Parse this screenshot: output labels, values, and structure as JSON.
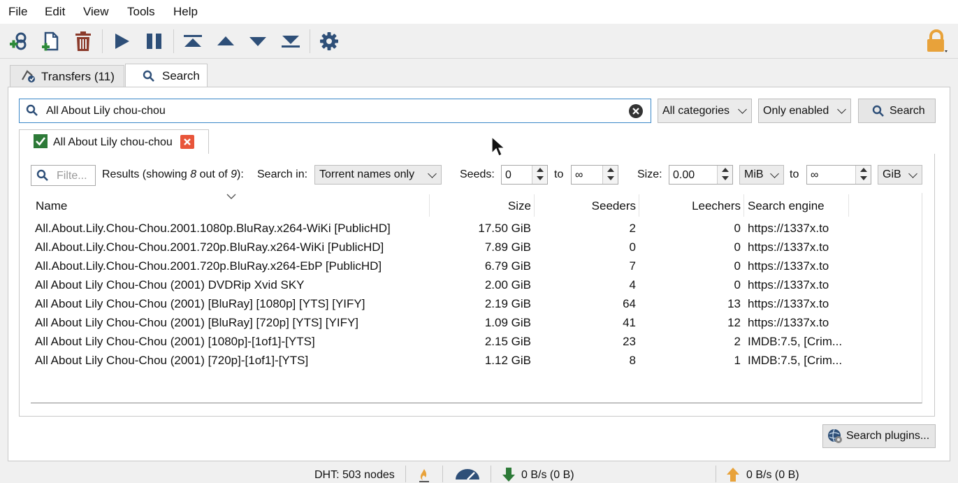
{
  "menu": {
    "items": [
      "File",
      "Edit",
      "View",
      "Tools",
      "Help"
    ]
  },
  "tabs": {
    "transfers_label": "Transfers (11)",
    "search_label": "Search"
  },
  "search": {
    "query": "All About Lily chou-chou",
    "category": "All categories",
    "plugins_filter": "Only enabled",
    "button_label": "Search"
  },
  "result_tab": {
    "label": "All About Lily chou-chou"
  },
  "filters": {
    "filter_placeholder": "Filte...",
    "results_text": "Results (showing ",
    "showing": "8",
    "out_of_text": " out of ",
    "total": "9",
    "results_end": "):",
    "search_in_label": "Search in:",
    "search_in_value": "Torrent names only",
    "seeds_label": "Seeds:",
    "seeds_min": "0",
    "to_label": "to",
    "seeds_max": "∞",
    "size_label": "Size:",
    "size_min": "0.00",
    "size_min_unit": "MiB",
    "size_max": "∞",
    "size_max_unit": "GiB"
  },
  "table": {
    "headers": {
      "name": "Name",
      "size": "Size",
      "seeders": "Seeders",
      "leechers": "Leechers",
      "engine": "Search engine"
    },
    "rows": [
      {
        "name": "All.About.Lily.Chou-Chou.2001.1080p.BluRay.x264-WiKi [PublicHD]",
        "size": "17.50 GiB",
        "seeders": "2",
        "leechers": "0",
        "engine": "https://1337x.to"
      },
      {
        "name": "All.About.Lily.Chou-Chou.2001.720p.BluRay.x264-WiKi [PublicHD]",
        "size": "7.89 GiB",
        "seeders": "0",
        "leechers": "0",
        "engine": "https://1337x.to"
      },
      {
        "name": "All.About.Lily.Chou-Chou.2001.720p.BluRay.x264-EbP [PublicHD]",
        "size": "6.79 GiB",
        "seeders": "7",
        "leechers": "0",
        "engine": "https://1337x.to"
      },
      {
        "name": "All About Lily Chou-Chou (2001) DVDRip Xvid SKY",
        "size": "2.00 GiB",
        "seeders": "4",
        "leechers": "0",
        "engine": "https://1337x.to"
      },
      {
        "name": "All About Lily Chou-Chou (2001) [BluRay] [1080p] [YTS] [YIFY]",
        "size": "2.19 GiB",
        "seeders": "64",
        "leechers": "13",
        "engine": "https://1337x.to"
      },
      {
        "name": "All About Lily Chou-Chou (2001) [BluRay] [720p] [YTS] [YIFY]",
        "size": "1.09 GiB",
        "seeders": "41",
        "leechers": "12",
        "engine": "https://1337x.to"
      },
      {
        "name": "All About Lily Chou-Chou (2001) [1080p]-[1of1]-[YTS]",
        "size": "2.15 GiB",
        "seeders": "23",
        "leechers": "2",
        "engine": "IMDB:7.5, [Crim..."
      },
      {
        "name": "All About Lily Chou-Chou (2001) [720p]-[1of1]-[YTS]",
        "size": "1.12 GiB",
        "seeders": "8",
        "leechers": "1",
        "engine": "IMDB:7.5, [Crim..."
      }
    ]
  },
  "plugins_button": "Search plugins...",
  "status": {
    "dht": "DHT: 503 nodes",
    "download": "0 B/s (0 B)",
    "upload": "0 B/s (0 B)"
  },
  "colors": {
    "accent": "#3a87c8",
    "icon_blue": "#2e4f78",
    "add_green": "#2d8a3a",
    "delete_red": "#8b3a2a",
    "lock_orange": "#e8a23a",
    "close_red": "#e8553a"
  }
}
